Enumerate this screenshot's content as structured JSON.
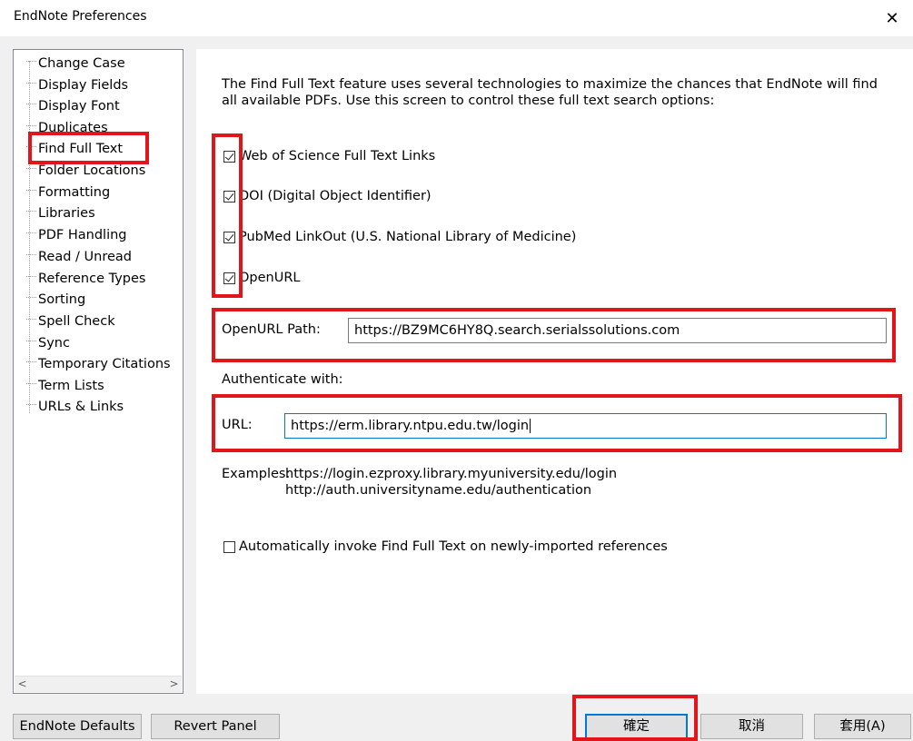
{
  "window": {
    "title": "EndNote Preferences",
    "close_glyph": "✕"
  },
  "sidebar": {
    "selected": "Find Full Text",
    "items": [
      {
        "label": "Change Case"
      },
      {
        "label": "Display Fields"
      },
      {
        "label": "Display Font"
      },
      {
        "label": "Duplicates"
      },
      {
        "label": "Find Full Text"
      },
      {
        "label": "Folder Locations"
      },
      {
        "label": "Formatting"
      },
      {
        "label": "Libraries"
      },
      {
        "label": "PDF Handling"
      },
      {
        "label": "Read / Unread"
      },
      {
        "label": "Reference Types"
      },
      {
        "label": "Sorting"
      },
      {
        "label": "Spell Check"
      },
      {
        "label": "Sync"
      },
      {
        "label": "Temporary Citations"
      },
      {
        "label": "Term Lists"
      },
      {
        "label": "URLs & Links"
      }
    ],
    "scroll_left_glyph": "<",
    "scroll_right_glyph": ">"
  },
  "panel": {
    "description_line1": "The Find Full Text feature uses several technologies to maximize the chances that EndNote will find",
    "description_line2": "all available PDFs. Use this screen to control these full text search options:",
    "options": [
      {
        "label": "Web of Science Full Text Links",
        "checked": true
      },
      {
        "label": "DOI (Digital Object Identifier)",
        "checked": true
      },
      {
        "label": "PubMed LinkOut (U.S. National Library of Medicine)",
        "checked": true
      },
      {
        "label": "OpenURL",
        "checked": true
      }
    ],
    "openurl_path_label": "OpenURL Path:",
    "openurl_path_value": "https://BZ9MC6HY8Q.search.serialssolutions.com",
    "authenticate_label": "Authenticate with:",
    "url_label": "URL:",
    "url_value": "https://erm.library.ntpu.edu.tw/login",
    "examples_label": "Examples:",
    "example1": "https://login.ezproxy.library.myuniversity.edu/login",
    "example2": "http://auth.universityname.edu/authentication",
    "auto_invoke_label": "Automatically invoke Find Full Text on newly-imported references",
    "auto_invoke_checked": false
  },
  "footer": {
    "endnote_defaults": "EndNote Defaults",
    "revert_panel": "Revert Panel",
    "ok": "確定",
    "cancel": "取消",
    "apply": "套用(A)"
  },
  "colors": {
    "highlight_box": "#e0161b",
    "focus_border": "#0078d7"
  }
}
